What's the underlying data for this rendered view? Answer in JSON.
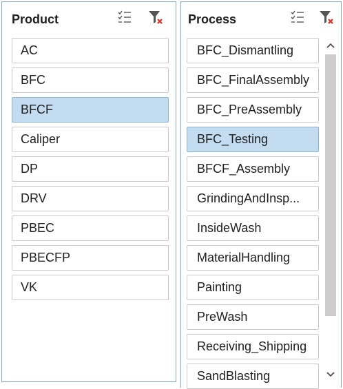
{
  "product": {
    "title": "Product",
    "items": [
      {
        "label": "AC",
        "selected": false
      },
      {
        "label": "BFC",
        "selected": false
      },
      {
        "label": "BFCF",
        "selected": true
      },
      {
        "label": "Caliper",
        "selected": false
      },
      {
        "label": "DP",
        "selected": false
      },
      {
        "label": "DRV",
        "selected": false
      },
      {
        "label": "PBEC",
        "selected": false
      },
      {
        "label": "PBECFP",
        "selected": false
      },
      {
        "label": "VK",
        "selected": false
      }
    ]
  },
  "process": {
    "title": "Process",
    "items": [
      {
        "label": "BFC_Dismantling",
        "selected": false
      },
      {
        "label": "BFC_FinalAssembly",
        "selected": false
      },
      {
        "label": "BFC_PreAssembly",
        "selected": false
      },
      {
        "label": "BFC_Testing",
        "selected": true
      },
      {
        "label": "BFCF_Assembly",
        "selected": false
      },
      {
        "label": "GrindingAndInsp...",
        "selected": false
      },
      {
        "label": "InsideWash",
        "selected": false
      },
      {
        "label": "MaterialHandling",
        "selected": false
      },
      {
        "label": "Painting",
        "selected": false
      },
      {
        "label": "PreWash",
        "selected": false
      },
      {
        "label": "Receiving_Shipping",
        "selected": false
      },
      {
        "label": "SandBlasting",
        "selected": false
      }
    ]
  },
  "icons": {
    "multi_select": "multi-select-icon",
    "clear_filter": "clear-filter-icon",
    "scroll_up": "chevron-up-icon",
    "scroll_down": "chevron-down-icon"
  },
  "colors": {
    "selected_fill": "#c3dcf0",
    "selected_border": "#8db2d2",
    "slicer_border": "#7fa6c3",
    "clear_x": "#e0301e"
  }
}
